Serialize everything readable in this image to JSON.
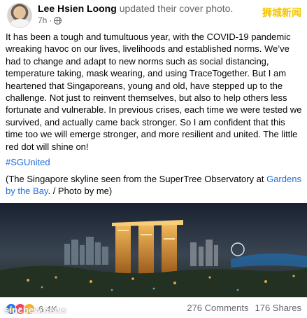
{
  "header": {
    "author": "Lee Hsien Loong",
    "action": "updated their cover photo.",
    "time": "7h",
    "separator": "·",
    "privacy_icon": "globe-icon"
  },
  "watermark": "狮城新闻",
  "post": {
    "paragraph": "It has been a tough and tumultuous year, with the COVID-19 pandemic wreaking havoc on our lives, livelihoods and established norms. We’ve had to change and adapt to new norms such as social distancing, temperature taking, mask wearing, and using TraceTogether. But I am heartened that Singaporeans, young and old, have stepped up to the challenge. Not just to reinvent themselves, but also to help others less fortunate and vulnerable. In previous crises, each time we were tested we survived, and actually came back stronger. So I am confident that this time too we will emerge stronger, and more resilient and united. The little red dot will shine on!",
    "hashtag": "#SGUnited",
    "caption_prefix": "(The Singapore skyline seen from the SuperTree Observatory at ",
    "caption_link": "Gardens by the Bay",
    "caption_suffix": ". / Photo by me)"
  },
  "footer": {
    "reaction_count": "6.4K",
    "comments": "276 Comments",
    "shares": "176 Shares",
    "source_mark": "sinchew.news",
    "reactions": [
      "like-icon",
      "love-icon",
      "care-icon"
    ]
  },
  "colors": {
    "link": "#216fdb",
    "muted": "#65676b",
    "watermark": "#f2c500"
  }
}
